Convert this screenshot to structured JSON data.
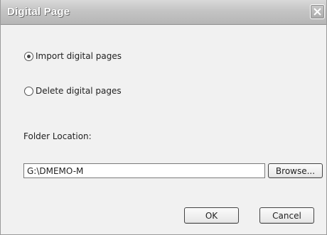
{
  "window": {
    "title": "Digital Page"
  },
  "options": [
    {
      "label": "Import digital pages",
      "checked": true
    },
    {
      "label": "Delete digital pages",
      "checked": false
    }
  ],
  "folder": {
    "label": "Folder Location:",
    "value": "G:\\DMEMO-M"
  },
  "buttons": {
    "browse": "Browse...",
    "ok": "OK",
    "cancel": "Cancel"
  },
  "icons": {
    "close": "close-icon"
  },
  "colors": {
    "titlebar": "#c4c4c4",
    "dialog_background": "#f1f1f1"
  }
}
